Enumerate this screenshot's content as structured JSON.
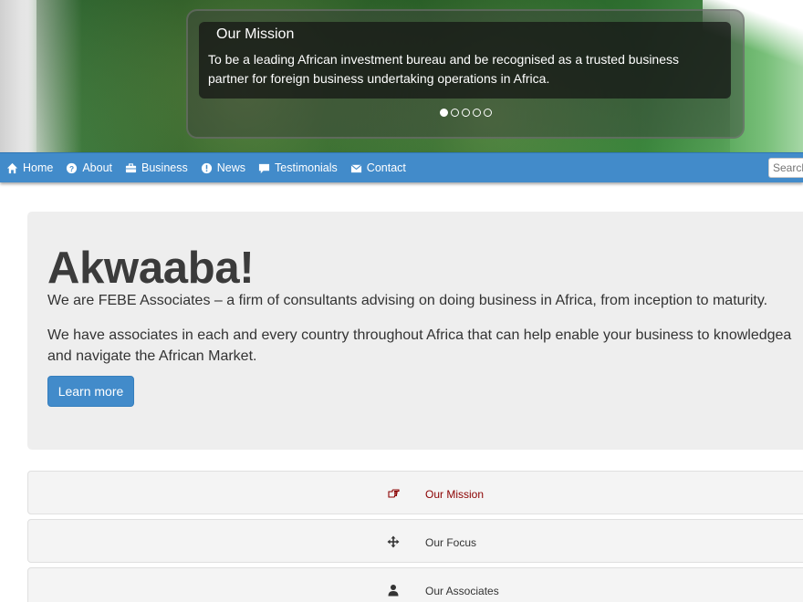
{
  "hero": {
    "caption_title": "Our Mission",
    "caption_text_line1": "To be a leading African investment bureau and be recognised as a trusted business",
    "caption_text_line2": "partner for foreign business undertaking operations in Africa.",
    "slide_count": 5,
    "active_slide": 1
  },
  "nav": {
    "items": [
      {
        "label": "Home",
        "icon": "home-icon"
      },
      {
        "label": "About",
        "icon": "question-circle-icon"
      },
      {
        "label": "Business",
        "icon": "briefcase-icon"
      },
      {
        "label": "News",
        "icon": "info-circle-icon"
      },
      {
        "label": "Testimonials",
        "icon": "comment-icon"
      },
      {
        "label": "Contact",
        "icon": "envelope-icon"
      }
    ],
    "search_placeholder": "Search"
  },
  "jumbotron": {
    "heading": "Akwaaba!",
    "paragraph1": "We are FEBE Associates – a firm of consultants advising on doing business in Africa, from inception to maturity.",
    "paragraph2_line1": "We have associates in each and every country throughout Africa that can help enable your business to knowledgea",
    "paragraph2_line2": "and navigate the African Market.",
    "button_label": "Learn more"
  },
  "features": [
    {
      "label": "Our Mission",
      "icon": "hand-pointing-icon",
      "color": "#8b0000"
    },
    {
      "label": "Our Focus",
      "icon": "move-arrows-icon",
      "color": "#333333"
    },
    {
      "label": "Our Associates",
      "icon": "user-icon",
      "color": "#333333"
    }
  ],
  "colors": {
    "navbar": "#428bca",
    "button": "#428bca",
    "jumbotron_bg": "#eeeeee",
    "mission_text": "#8b0000"
  }
}
